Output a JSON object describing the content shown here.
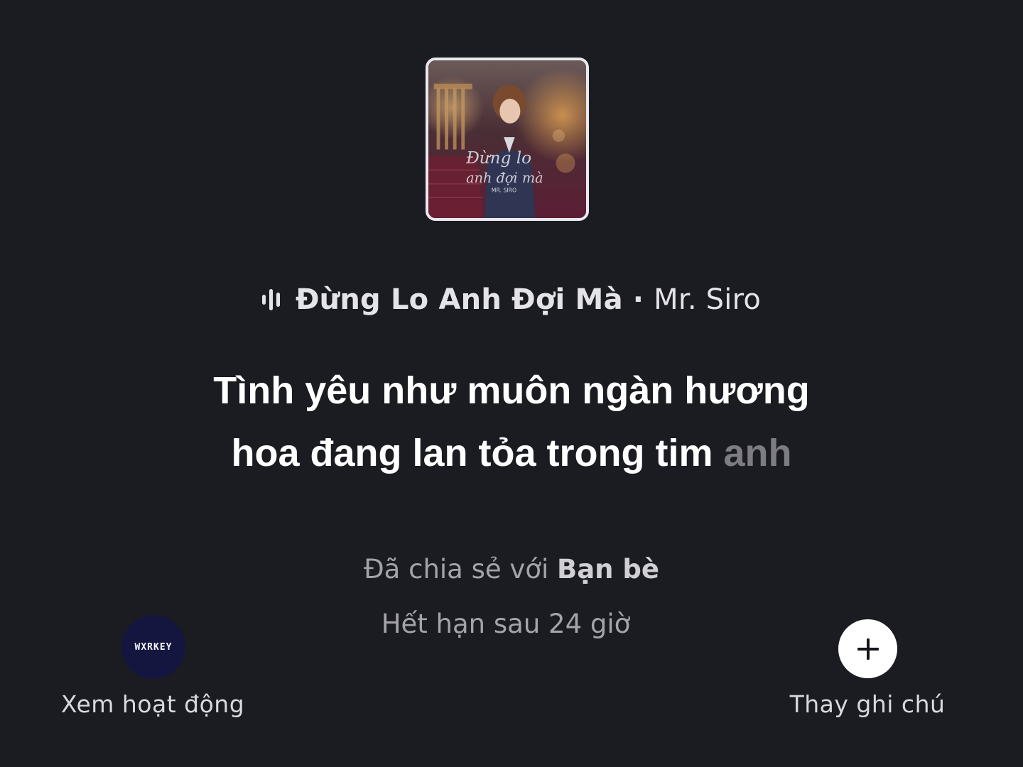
{
  "album": {
    "cover_title_line1": "Đừng lo",
    "cover_title_line2": "anh đợi mà",
    "cover_artist": "MR. SIRO"
  },
  "now_playing": {
    "icon": "audio-wave-icon",
    "title": "Đừng Lo Anh Đợi Mà",
    "separator": "·",
    "artist": "Mr. Siro"
  },
  "lyrics": {
    "line1": "Tình yêu như muôn ngàn hương",
    "line2_active": "hoa đang lan tỏa trong tim",
    "line2_upcoming": "anh"
  },
  "share": {
    "prefix": "Đã chia sẻ với",
    "audience": "Bạn bè",
    "expiry": "Hết hạn sau 24 giờ"
  },
  "bottom": {
    "avatar_text": "WXRKEY",
    "activity_label": "Xem hoạt động",
    "change_note_icon": "plus-icon",
    "change_note_label": "Thay ghi chú"
  }
}
